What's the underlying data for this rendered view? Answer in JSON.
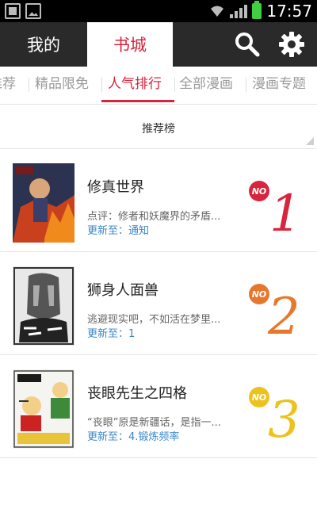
{
  "status_bar": {
    "time": "17:57",
    "icons": [
      "sim-icon",
      "image-icon",
      "wifi-icon",
      "signal-icon",
      "battery-icon"
    ],
    "battery_color": "#3fcf3f"
  },
  "top_nav": {
    "tabs": [
      {
        "label": "我的",
        "active": false
      },
      {
        "label": "书城",
        "active": true
      }
    ],
    "actions": [
      "search-icon",
      "settings-icon"
    ]
  },
  "category_tabs": {
    "items": [
      {
        "label": "推荐",
        "active": false
      },
      {
        "label": "精品限免",
        "active": false
      },
      {
        "label": "人气排行",
        "active": true
      },
      {
        "label": "全部漫画",
        "active": false
      },
      {
        "label": "漫画专题",
        "active": false
      }
    ]
  },
  "section": {
    "title": "推荐榜"
  },
  "rank_list": [
    {
      "rank": "1",
      "badge": "NO",
      "color": "#d8243c",
      "title": "修真世界",
      "desc": "点评：修者和妖魔界的矛盾...",
      "update": "更新至：通知"
    },
    {
      "rank": "2",
      "badge": "NO",
      "color": "#e8772e",
      "title": "狮身人面兽",
      "desc": "逃避现实吧，不如活在梦里...",
      "update": "更新至：1"
    },
    {
      "rank": "3",
      "badge": "NO",
      "color": "#eec21c",
      "title": "丧眼先生之四格",
      "desc": "“丧眼”原是新疆话，是指一...",
      "update": "更新至：4.锻炼频率"
    }
  ],
  "colors": {
    "accent": "#d8243c",
    "nav_bg": "#2a2a2a",
    "link": "#3a86c8"
  }
}
